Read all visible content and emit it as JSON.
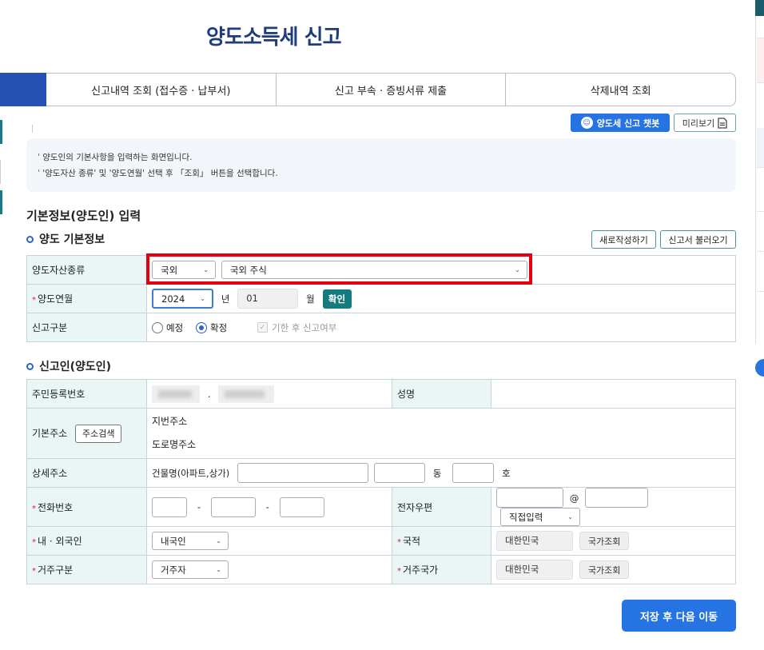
{
  "page_title": "양도소득세 신고",
  "tabs": [
    "신고내역 조회 (접수증 · 납부서)",
    "신고 부속 · 증빙서류 제출",
    "삭제내역 조회"
  ],
  "top_buttons": {
    "chatbot": "양도세 신고 챗봇",
    "preview": "미리보기"
  },
  "info_lines": [
    "양도인의 기본사항을 입력하는 화면입니다.",
    "'양도자산 종류' 및 '양도연월' 선택 후 「조회」 버튼을 선택합니다."
  ],
  "section_main": "기본정보(양도인) 입력",
  "section1": {
    "title": "양도 기본정보",
    "new_btn": "새로작성하기",
    "load_btn": "신고서 불러오기",
    "asset_type_label": "양도자산종류",
    "asset_region": "국외",
    "asset_kind": "국외 주식",
    "transfer_ym_label": "양도연월",
    "year": "2024",
    "year_unit": "년",
    "month": "01",
    "month_unit": "월",
    "confirm": "확인",
    "report_type_label": "신고구분",
    "radio_pre": "예정",
    "radio_final": "확정",
    "late_check": "기한 후 신고여부"
  },
  "section2": {
    "title": "신고인(양도인)",
    "rrn_label": "주민등록번호",
    "name_label": "성명",
    "address_label": "기본주소",
    "address_search": "주소검색",
    "jibun": "지번주소",
    "road": "도로명주소",
    "detail_label": "상세주소",
    "building_label": "건물명(아파트,상가)",
    "dong": "동",
    "ho": "호",
    "phone_label": "전화번호",
    "dash": "-",
    "email_label": "전자우편",
    "at": "@",
    "email_domain": "직접입력",
    "nationality_type_label": "내 · 외국인",
    "nationality_type": "내국인",
    "nationality_label": "국적",
    "nationality": "대한민국",
    "country_search": "국가조회",
    "residence_label": "거주구분",
    "residence": "거주자",
    "residence_country_label": "거주국가",
    "residence_country": "대한민국"
  },
  "save_next": "저장 후 다음 이동",
  "colors": {
    "primary": "#2673e3",
    "title": "#1e3d7a",
    "teal": "#167b7f",
    "highlight": "#e5000f"
  }
}
